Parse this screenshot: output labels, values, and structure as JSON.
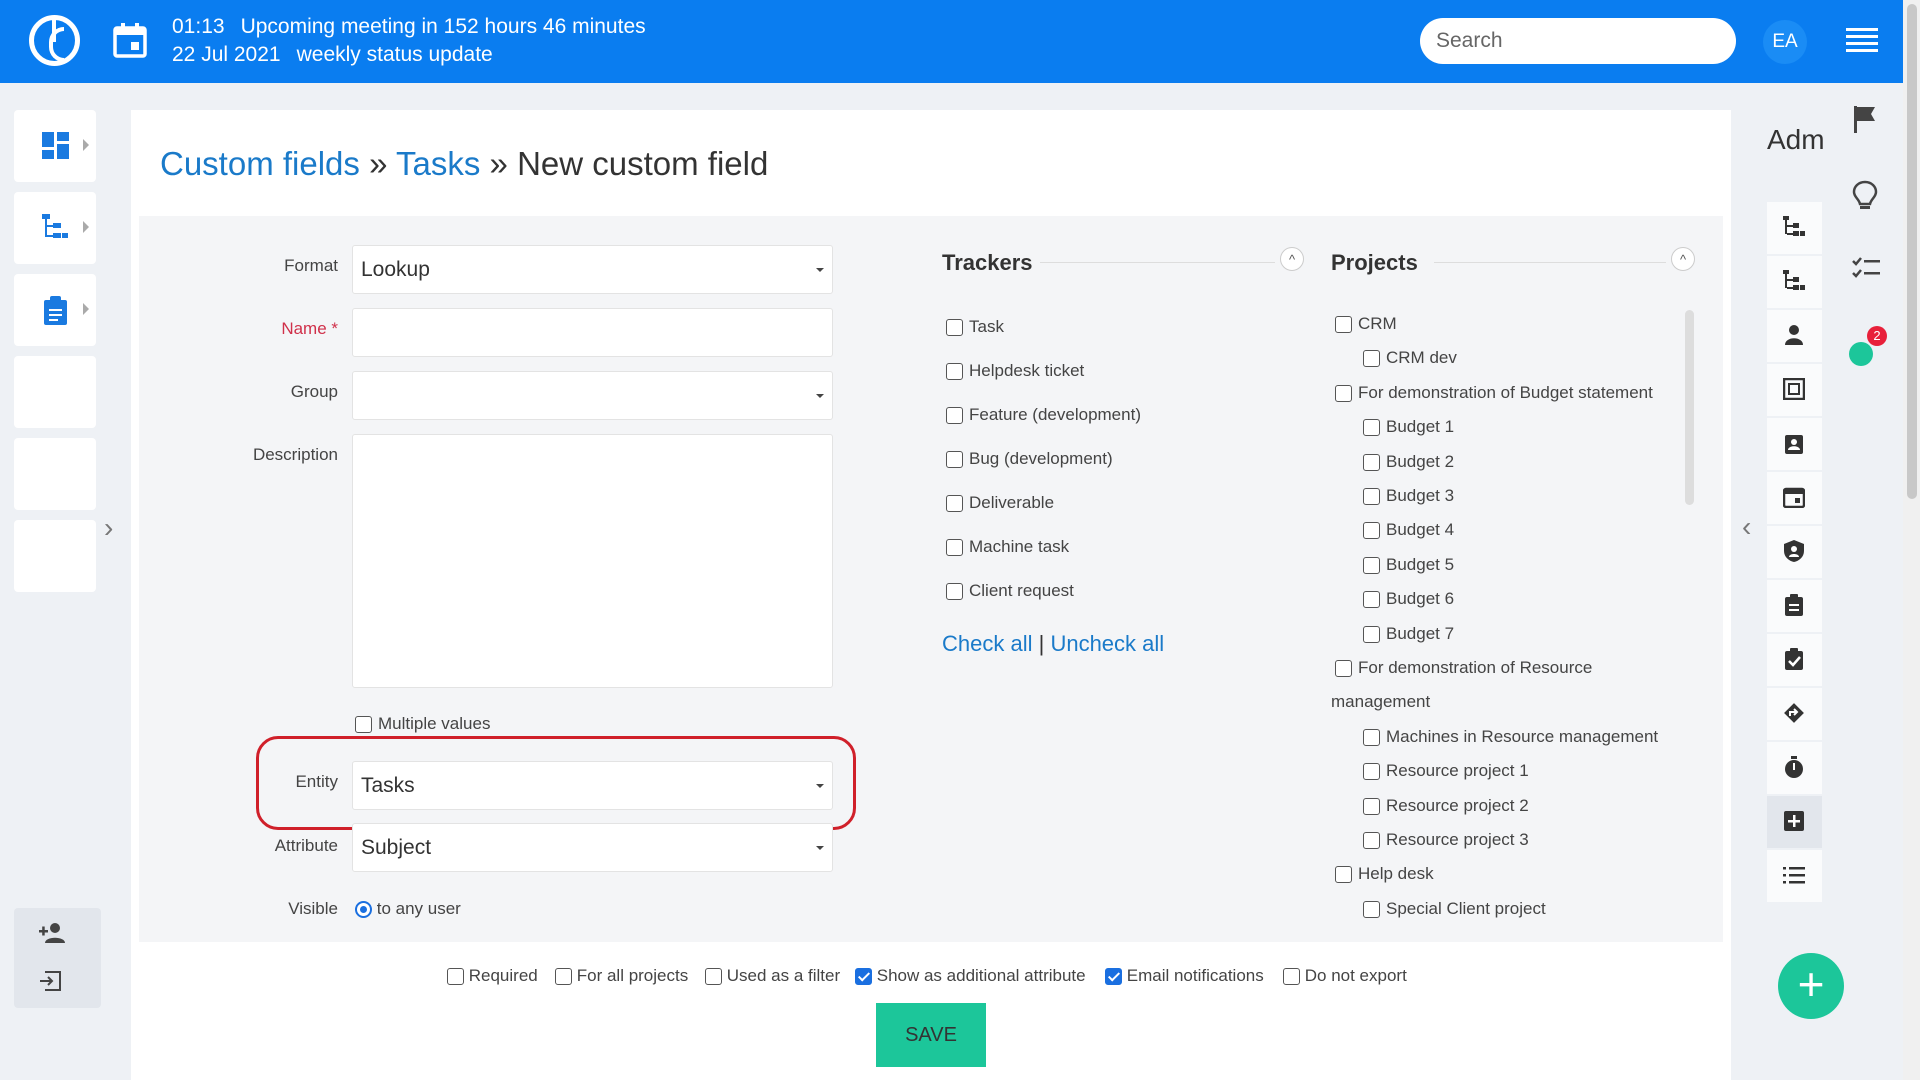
{
  "topbar": {
    "time": "01:13",
    "meeting_text": "Upcoming meeting in 152 hours 46 minutes",
    "date": "22 Jul 2021",
    "meeting_title": "weekly status update",
    "search_placeholder": "Search",
    "avatar_initials": "EA"
  },
  "breadcrumb": {
    "link1": "Custom fields",
    "sep1": " » ",
    "link2": "Tasks",
    "sep2": " » ",
    "current": "New custom field"
  },
  "form": {
    "format_label": "Format",
    "format_value": "Lookup",
    "name_label": "Name *",
    "group_label": "Group",
    "description_label": "Description",
    "multiple_values_label": "Multiple values",
    "entity_label": "Entity",
    "entity_value": "Tasks",
    "attribute_label": "Attribute",
    "attribute_value": "Subject",
    "visible_label": "Visible",
    "visible_value": "to any user"
  },
  "trackers": {
    "title": "Trackers",
    "items": [
      "Task",
      "Helpdesk ticket",
      "Feature (development)",
      "Bug (development)",
      "Deliverable",
      "Machine task",
      "Client request"
    ],
    "check_all": "Check all",
    "separator": "|",
    "uncheck_all": "Uncheck all"
  },
  "projects": {
    "title": "Projects",
    "items": [
      {
        "label": "CRM",
        "level": 0
      },
      {
        "label": "CRM dev",
        "level": 1
      },
      {
        "label": "For demonstration of Budget statement",
        "level": 0
      },
      {
        "label": "Budget 1",
        "level": 1
      },
      {
        "label": "Budget 2",
        "level": 1
      },
      {
        "label": "Budget 3",
        "level": 1
      },
      {
        "label": "Budget 4",
        "level": 1
      },
      {
        "label": "Budget 5",
        "level": 1
      },
      {
        "label": "Budget 6",
        "level": 1
      },
      {
        "label": "Budget 7",
        "level": 1
      },
      {
        "label": "For demonstration of Resource",
        "level": 0
      },
      {
        "label": "management",
        "level": -1
      },
      {
        "label": "Machines in Resource management",
        "level": 1
      },
      {
        "label": "Resource project 1",
        "level": 1
      },
      {
        "label": "Resource project 2",
        "level": 1
      },
      {
        "label": "Resource project 3",
        "level": 1
      },
      {
        "label": "Help desk",
        "level": 0
      },
      {
        "label": "Special Client project",
        "level": 1
      }
    ]
  },
  "options": {
    "required": "Required",
    "for_all_projects": "For all projects",
    "used_as_filter": "Used as a filter",
    "show_additional": "Show as additional attribute",
    "email_notifications": "Email notifications",
    "do_not_export": "Do not export"
  },
  "save_label": "SAVE",
  "right_panel": {
    "title": "Adm",
    "timer_badge": "2"
  },
  "colors": {
    "topbar": "#0a7df0",
    "link": "#1a7ac9",
    "save": "#1cc69a",
    "highlight": "#d0202a"
  }
}
